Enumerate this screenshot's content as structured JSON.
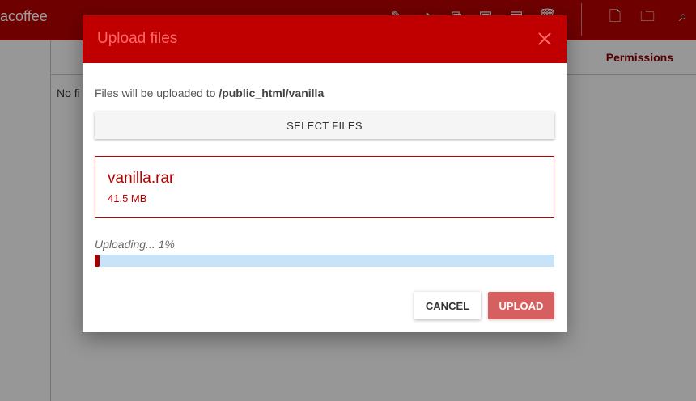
{
  "app": {
    "brand": "acoffee",
    "header": {
      "permissions_label": "Permissions"
    },
    "empty_text": "No fi",
    "toolbar_icons": [
      "rename-icon",
      "move-icon",
      "copy-icon",
      "archive-icon",
      "extract-icon",
      "delete-icon",
      "new-file-icon",
      "new-folder-icon",
      "search-icon"
    ]
  },
  "dialog": {
    "title": "Upload files",
    "destination_prefix": "Files will be uploaded to",
    "destination_path": "/public_html/vanilla",
    "select_files_label": "SELECT FILES",
    "file": {
      "name": "vanilla.rar",
      "size": "41.5 MB"
    },
    "status_text": "Uploading... 1%",
    "progress": 0.01,
    "cancel_label": "CANCEL",
    "upload_label": "UPLOAD"
  },
  "colors": {
    "brand": "#b40000",
    "dialog_header": "#c00000",
    "progress_track": "#c8e3f8",
    "progress_fill": "#a30000",
    "upload_button": "#d65f5f"
  }
}
